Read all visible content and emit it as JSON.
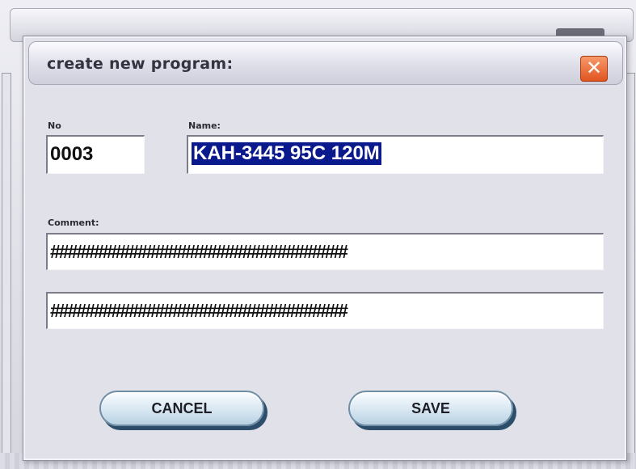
{
  "dialog": {
    "title": "create new program:",
    "close_glyph": "✕"
  },
  "fields": {
    "no_label": "No",
    "no_value": "0003",
    "name_label": "Name:",
    "name_value": "KAH-3445 95C 120M",
    "comment_label": "Comment:",
    "comment_line1": "##################################",
    "comment_line2": "##################################"
  },
  "buttons": {
    "cancel_label": "CANCEL",
    "save_label": "SAVE"
  },
  "colors": {
    "selection_bg": "#0a1a8c",
    "close_button": "#e0541f",
    "button_shadow": "#2c4e6a"
  }
}
